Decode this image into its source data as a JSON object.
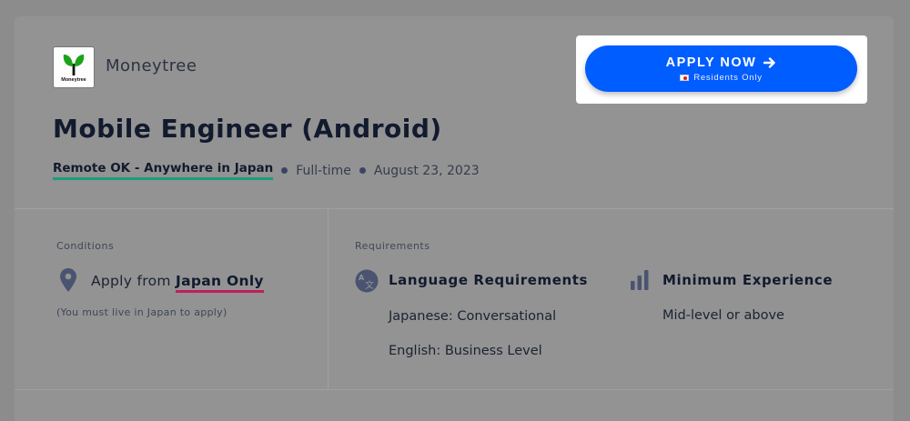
{
  "company": {
    "name": "Moneytree",
    "logo_text": "Moneytree"
  },
  "job": {
    "title": "Mobile Engineer (Android)",
    "location": "Remote OK - Anywhere in Japan",
    "type": "Full-time",
    "date": "August 23, 2023"
  },
  "apply": {
    "label": "APPLY NOW",
    "sublabel": "Residents Only"
  },
  "conditions": {
    "section_label": "Conditions",
    "apply_from_prefix": "Apply from",
    "apply_from_value": "Japan Only",
    "note": "(You must live in Japan to apply)"
  },
  "requirements": {
    "section_label": "Requirements",
    "language": {
      "heading": "Language Requirements",
      "items": [
        "Japanese: Conversational",
        "English: Business Level"
      ]
    },
    "experience": {
      "heading": "Minimum Experience",
      "value": "Mid-level or above"
    }
  },
  "colors": {
    "accent": "#005dff",
    "location_underline": "#1c9c7c",
    "japan_underline": "#c21d5c"
  },
  "icons": [
    "moneytree-logo",
    "arrow-right-icon",
    "japan-flag-icon",
    "location-pin-icon",
    "translate-icon",
    "bar-chart-icon"
  ]
}
